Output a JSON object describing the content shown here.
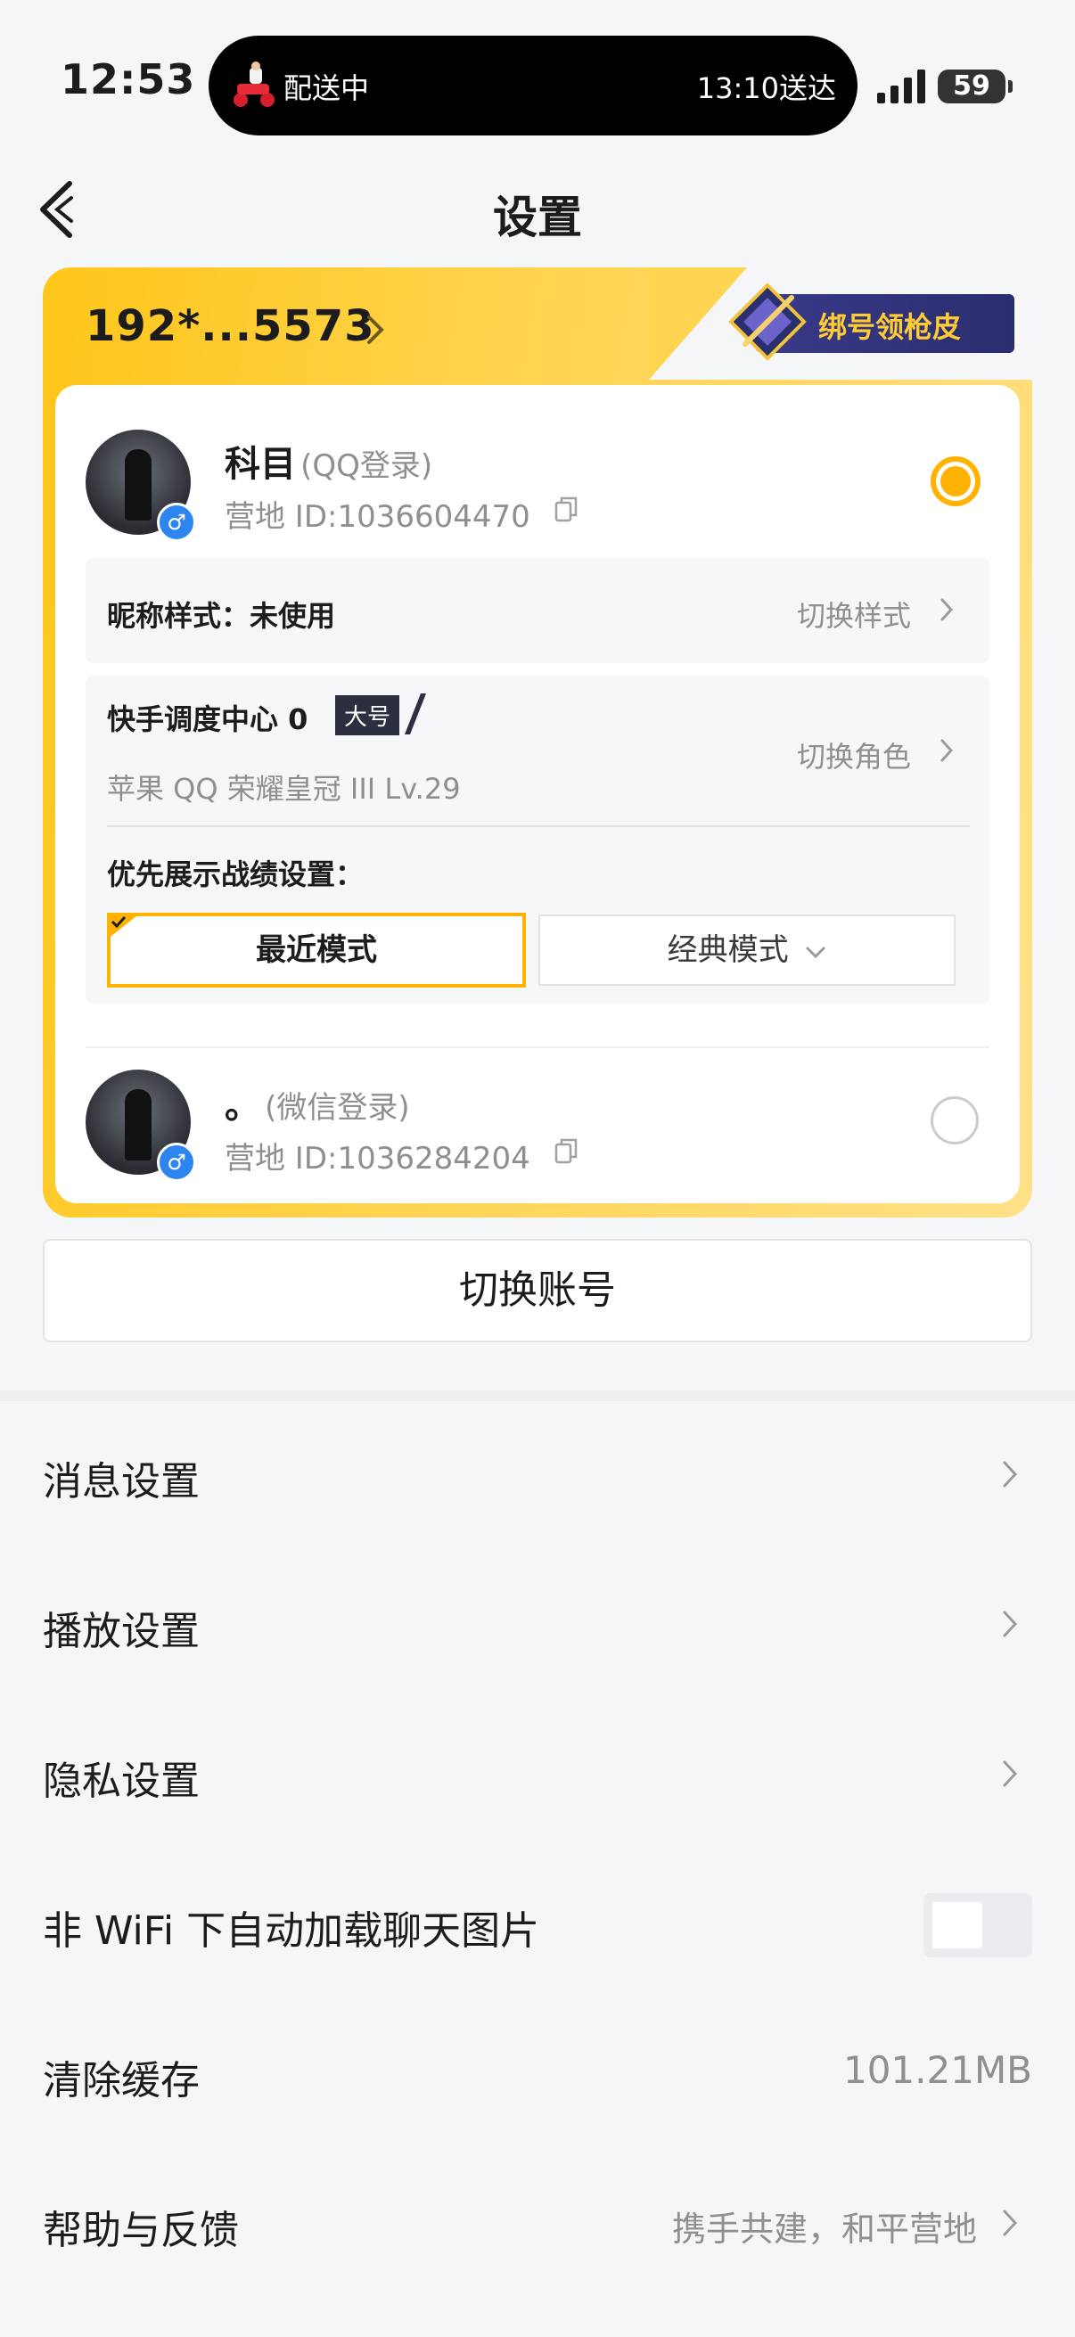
{
  "status_bar": {
    "time": "12:53",
    "live_activity": {
      "status": "配送中",
      "eta": "13:10送达"
    },
    "battery": "59"
  },
  "nav": {
    "title": "设置"
  },
  "account_card": {
    "phone": "192*...5573",
    "promo": "绑号领枪皮",
    "accounts": [
      {
        "name": "科目",
        "login": "(QQ登录)",
        "id": "营地 ID:1036604470",
        "selected": true
      },
      {
        "name": "。",
        "login": "(微信登录)",
        "id": "营地 ID:1036284204",
        "selected": false
      }
    ],
    "nickname_style": {
      "label": "昵称样式：未使用",
      "action": "切换样式"
    },
    "role": {
      "name": "快手调度中心 0",
      "tag": "大号",
      "detail": "苹果 QQ  荣耀皇冠 III  Lv.29",
      "action": "切换角色"
    },
    "record_setting": {
      "label": "优先展示战绩设置：",
      "modes": [
        "最近模式",
        "经典模式"
      ],
      "selected": "最近模式"
    }
  },
  "switch_account": "切换账号",
  "settings": [
    {
      "label": "消息设置"
    },
    {
      "label": "播放设置"
    },
    {
      "label": "隐私设置"
    },
    {
      "label": "非 WiFi 下自动加载聊天图片",
      "toggle": false
    },
    {
      "label": "清除缓存",
      "value": "101.21MB"
    },
    {
      "label": "帮助与反馈",
      "value": "携手共建，和平营地"
    }
  ],
  "colors": {
    "accent": "#ffb300",
    "card_gradient_start": "#ffc61a",
    "promo_bg": "#2a2d6e"
  }
}
